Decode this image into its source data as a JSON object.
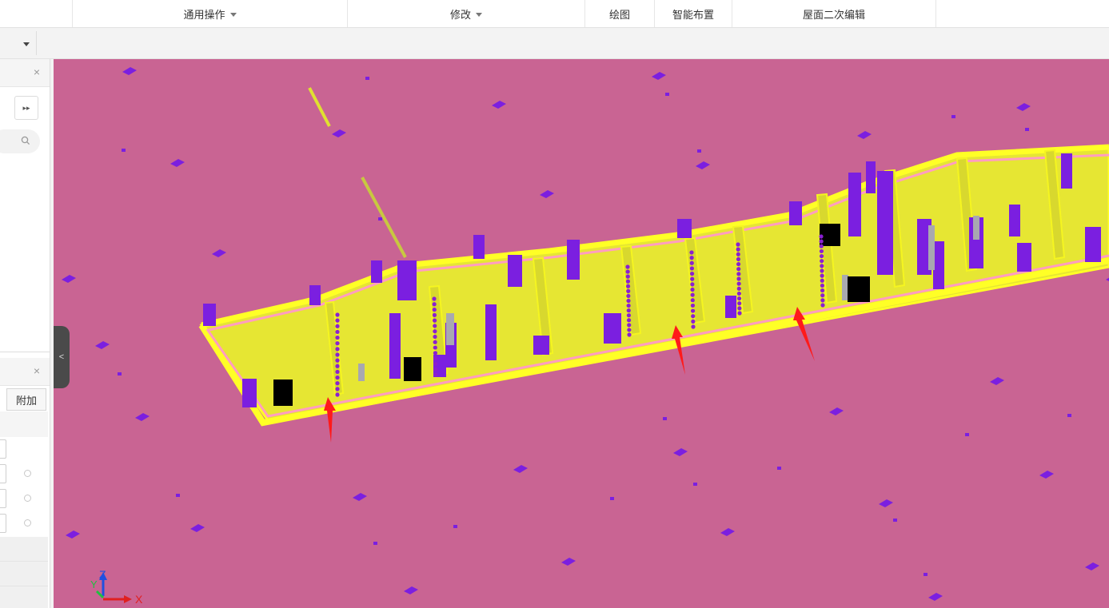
{
  "ribbon": {
    "groups": [
      {
        "label": "通用操作",
        "has_dropdown": true
      },
      {
        "label": "修改",
        "has_dropdown": true
      },
      {
        "label": "绘图",
        "has_dropdown": false
      },
      {
        "label": "智能布置",
        "has_dropdown": false
      },
      {
        "label": "屋面二次编辑",
        "has_dropdown": false
      }
    ]
  },
  "left_panel": {
    "top_section": {
      "expand_glyph": "▸▸",
      "close_glyph": "×"
    },
    "props_section": {
      "close_glyph": "×",
      "column_tab": "附加"
    }
  },
  "viewport": {
    "background": "#c96493",
    "axes": {
      "z_label": "Z",
      "y_label": "Y",
      "x_label": "X"
    },
    "colors": {
      "wall": "#e8e833",
      "outline": "#ffff26",
      "column": "#7b1fe0",
      "opening": "#000000",
      "rebar": "#8a20d0",
      "arrow": "#ff1a1a",
      "beam": "#ff9dc0"
    }
  }
}
